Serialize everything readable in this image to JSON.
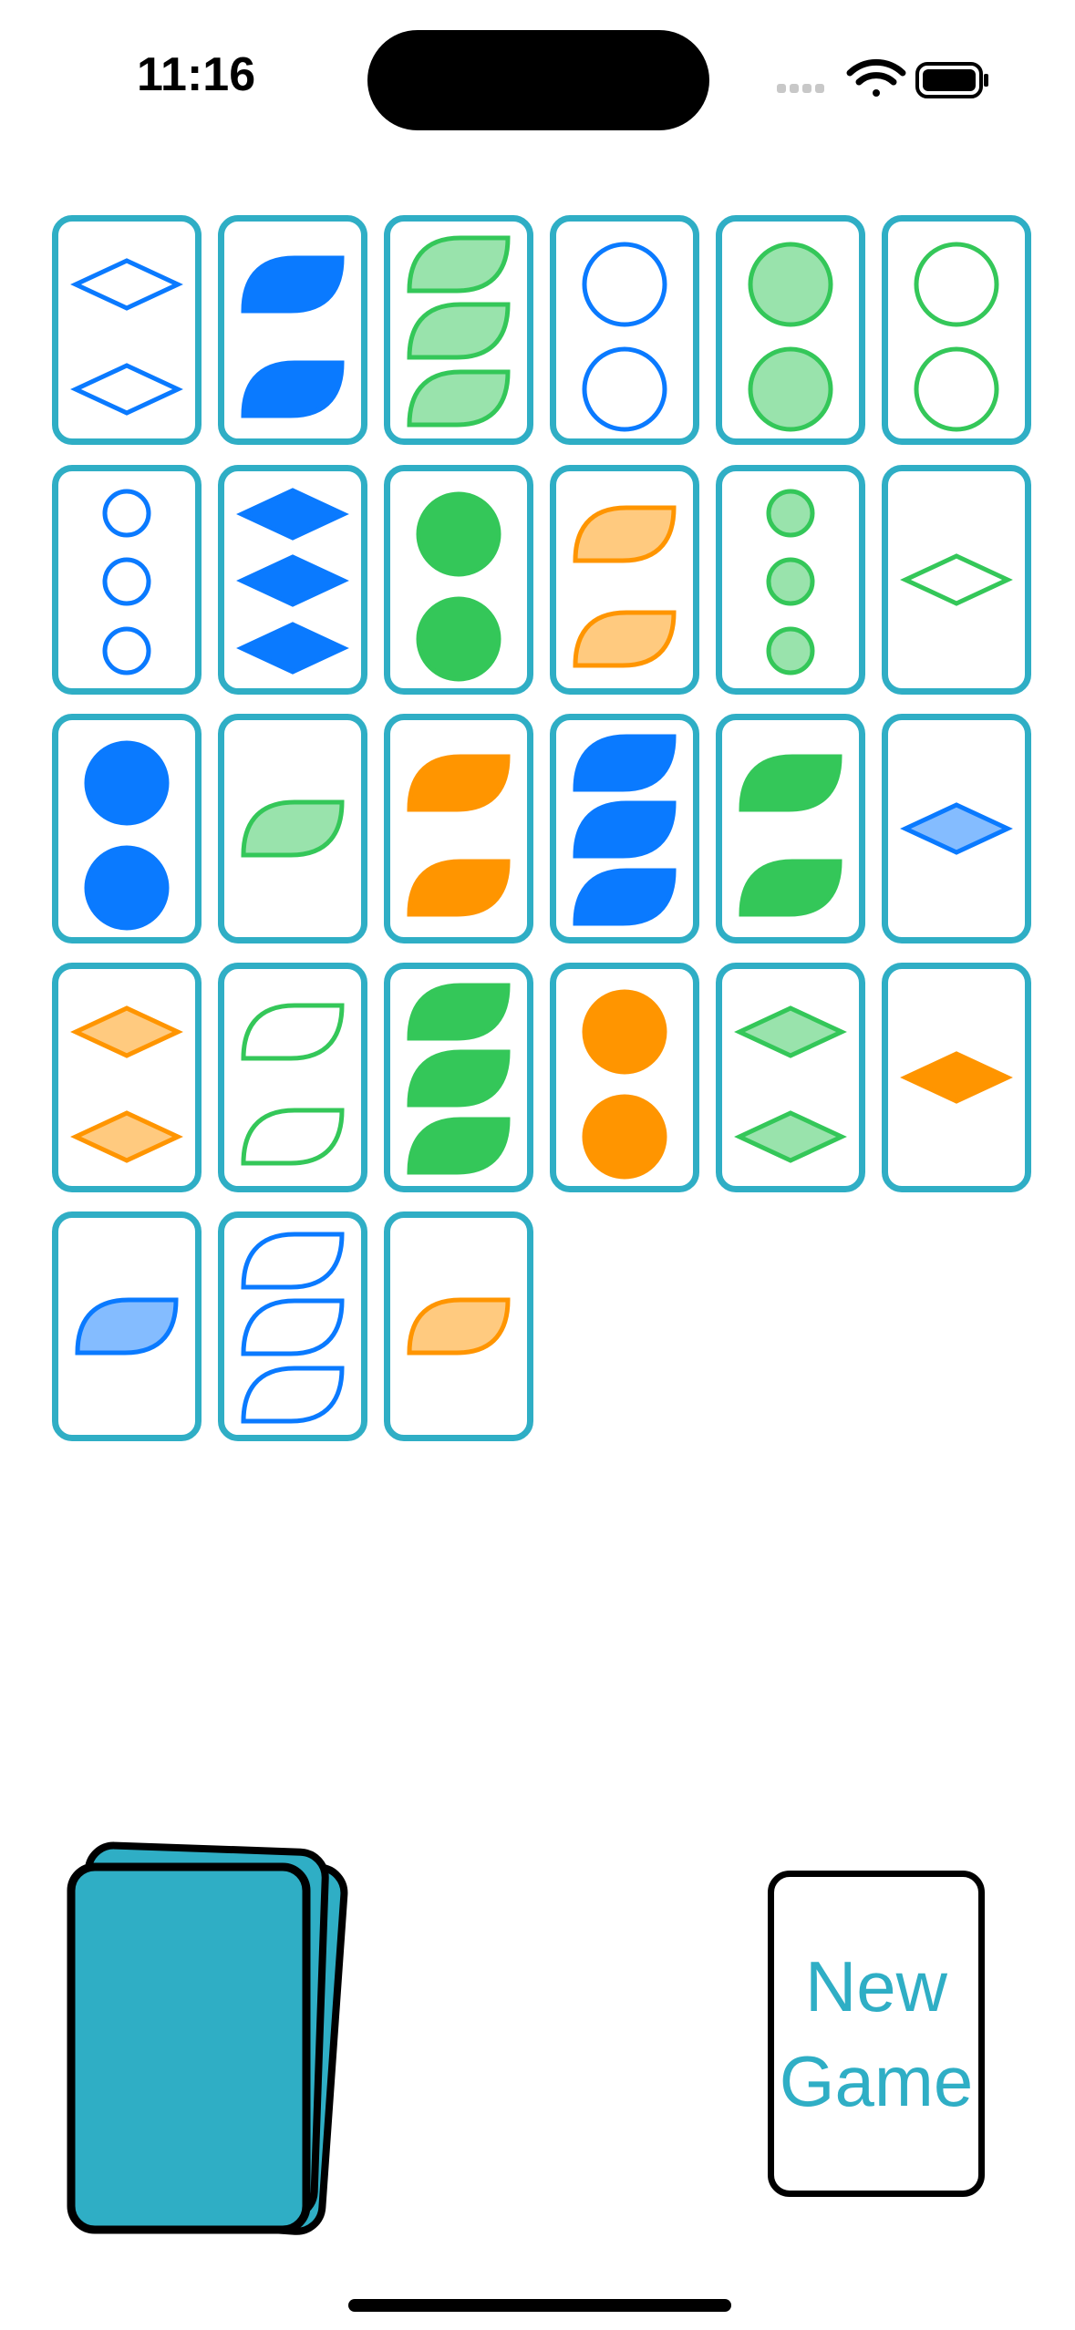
{
  "status_bar": {
    "time": "11:16",
    "icons": [
      "cellular-icon",
      "wifi-icon",
      "battery-icon"
    ]
  },
  "colors": {
    "card_border": "#2FAEC5",
    "deck_fill": "#2FAEC5",
    "blue": "#0A7AFF",
    "green": "#34C759",
    "orange": "#FF9500",
    "button_text": "#2FAEC5"
  },
  "board": {
    "cards": [
      {
        "count": 2,
        "shape": "diamond",
        "color": "blue",
        "fill": "open"
      },
      {
        "count": 2,
        "shape": "squiggle",
        "color": "blue",
        "fill": "solid"
      },
      {
        "count": 3,
        "shape": "squiggle",
        "color": "green",
        "fill": "striped"
      },
      {
        "count": 2,
        "shape": "oval",
        "color": "blue",
        "fill": "open"
      },
      {
        "count": 2,
        "shape": "oval",
        "color": "green",
        "fill": "striped"
      },
      {
        "count": 2,
        "shape": "oval",
        "color": "green",
        "fill": "open"
      },
      {
        "count": 3,
        "shape": "oval",
        "color": "blue",
        "fill": "open"
      },
      {
        "count": 3,
        "shape": "diamond",
        "color": "blue",
        "fill": "solid"
      },
      {
        "count": 2,
        "shape": "oval",
        "color": "green",
        "fill": "solid"
      },
      {
        "count": 2,
        "shape": "squiggle",
        "color": "orange",
        "fill": "striped"
      },
      {
        "count": 3,
        "shape": "oval",
        "color": "green",
        "fill": "striped"
      },
      {
        "count": 1,
        "shape": "diamond",
        "color": "green",
        "fill": "open"
      },
      {
        "count": 2,
        "shape": "oval",
        "color": "blue",
        "fill": "solid"
      },
      {
        "count": 1,
        "shape": "squiggle",
        "color": "green",
        "fill": "striped"
      },
      {
        "count": 2,
        "shape": "squiggle",
        "color": "orange",
        "fill": "solid"
      },
      {
        "count": 3,
        "shape": "squiggle",
        "color": "blue",
        "fill": "solid"
      },
      {
        "count": 2,
        "shape": "squiggle",
        "color": "green",
        "fill": "solid"
      },
      {
        "count": 1,
        "shape": "diamond",
        "color": "blue",
        "fill": "striped"
      },
      {
        "count": 2,
        "shape": "diamond",
        "color": "orange",
        "fill": "striped"
      },
      {
        "count": 2,
        "shape": "squiggle",
        "color": "green",
        "fill": "open"
      },
      {
        "count": 3,
        "shape": "squiggle",
        "color": "green",
        "fill": "solid"
      },
      {
        "count": 2,
        "shape": "oval",
        "color": "orange",
        "fill": "solid"
      },
      {
        "count": 2,
        "shape": "diamond",
        "color": "green",
        "fill": "striped"
      },
      {
        "count": 1,
        "shape": "diamond",
        "color": "orange",
        "fill": "solid"
      },
      {
        "count": 1,
        "shape": "squiggle",
        "color": "blue",
        "fill": "striped"
      },
      {
        "count": 3,
        "shape": "squiggle",
        "color": "blue",
        "fill": "open"
      },
      {
        "count": 1,
        "shape": "squiggle",
        "color": "orange",
        "fill": "striped"
      }
    ]
  },
  "deck": {
    "label": ""
  },
  "new_game": {
    "line1": "New",
    "line2": "Game"
  }
}
